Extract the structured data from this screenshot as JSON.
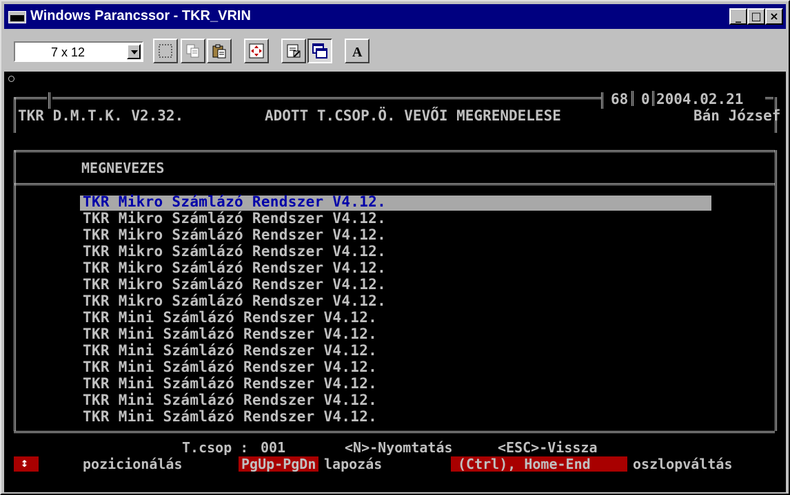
{
  "window": {
    "title": "Windows Parancssor - TKR_VRIN",
    "minimize": "_",
    "maximize": "□",
    "close": "×"
  },
  "toolbar": {
    "font_size": "7 x 12",
    "icons": [
      "mark-icon",
      "copy-icon",
      "paste-icon",
      "fullscreen-icon",
      "properties-icon",
      "background-icon",
      "font-icon"
    ],
    "font_button_label": "A"
  },
  "console": {
    "header_left": "TKR D.M.T.K. V2.32.",
    "header_title": "ADOTT T.CSOP.Ö. VEVŐI MEGRENDELESE",
    "counter_a": "68",
    "counter_b": "0",
    "date": "2004.02.21",
    "user": "Bán József",
    "column_header": "MEGNEVEZES",
    "rows": [
      "TKR Mikro Számlázó Rendszer V4.12.",
      "TKR Mikro Számlázó Rendszer V4.12.",
      "TKR Mikro Számlázó Rendszer V4.12.",
      "TKR Mikro Számlázó Rendszer V4.12.",
      "TKR Mikro Számlázó Rendszer V4.12.",
      "TKR Mikro Számlázó Rendszer V4.12.",
      "TKR Mikro Számlázó Rendszer V4.12.",
      "TKR Mini Számlázó Rendszer V4.12.",
      "TKR Mini Számlázó Rendszer V4.12.",
      "TKR Mini Számlázó Rendszer V4.12.",
      "TKR Mini Számlázó Rendszer V4.12.",
      "TKR Mini Számlázó Rendszer V4.12.",
      "TKR Mini Számlázó Rendszer V4.12.",
      "TKR Mini Számlázó Rendszer V4.12."
    ],
    "selected_row": 0,
    "footer": {
      "tcsop_label": "T.csop :",
      "tcsop_value": "001",
      "print_hint": "<N>-Nyomtatás",
      "back_hint": "<ESC>-Vissza",
      "arrow_key": "↕",
      "arrow_desc": "pozicionálás",
      "page_key": "PgUp-PgDn",
      "page_desc": "lapozás",
      "col_key": "(Ctrl), Home-End",
      "col_desc": "oszlopváltás"
    }
  },
  "colors": {
    "titlebar": "#000080",
    "console_bg": "#000000",
    "console_text": "#c0c0c0",
    "selection_bg": "#a8a8a8",
    "selection_text": "#0000a8",
    "key_badge": "#a80000"
  }
}
